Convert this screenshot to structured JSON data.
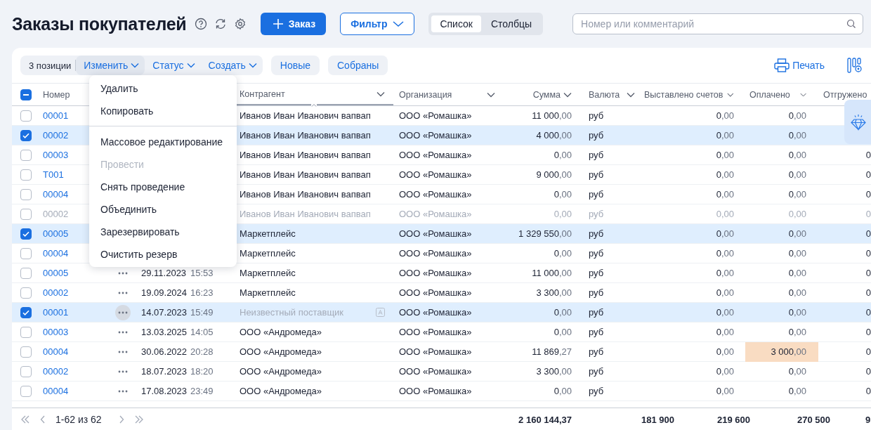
{
  "page": {
    "title": "Заказы покупателей"
  },
  "actions": {
    "add_button": "Заказ",
    "filter_button": "Фильтр",
    "views": [
      {
        "label": "Список",
        "selected": true
      },
      {
        "label": "Столбцы",
        "selected": false
      }
    ],
    "search": {
      "placeholder": "Номер или комментарий"
    }
  },
  "toolbar": {
    "count": "3 позиции",
    "menus": [
      {
        "label": "Изменить",
        "open": true
      },
      {
        "label": "Статус",
        "open": false
      },
      {
        "label": "Создать",
        "open": false
      }
    ],
    "quick_filters": [
      "Новые",
      "Собраны"
    ],
    "print": "Печать"
  },
  "edit_menu": [
    {
      "label": "Удалить",
      "disabled": false,
      "divider_after": false
    },
    {
      "label": "Копировать",
      "disabled": false,
      "divider_after": true
    },
    {
      "label": "Массовое редактирование",
      "disabled": false,
      "divider_after": false
    },
    {
      "label": "Провести",
      "disabled": true,
      "divider_after": false
    },
    {
      "label": "Снять проведение",
      "disabled": false,
      "divider_after": false
    },
    {
      "label": "Объединить",
      "disabled": false,
      "divider_after": false
    },
    {
      "label": "Зарезервировать",
      "disabled": false,
      "divider_after": false
    },
    {
      "label": "Очистить резерв",
      "disabled": false,
      "divider_after": false
    }
  ],
  "table": {
    "select_all": {
      "checked": true,
      "indeterminate": true
    },
    "columns": {
      "number": "Номер",
      "contractor": "Контрагент",
      "organization": "Организация",
      "sum": "Сумма",
      "currency": "Валюта",
      "invoiced": "Выставлено счетов",
      "paid": "Оплачено",
      "shipped": "Отгружено"
    },
    "rows": [
      {
        "number": "00001",
        "checked": false,
        "muted": false,
        "contractor": "Иванов Иван Иванович вапвап",
        "contractor_unknown": false,
        "organization": "ООО «Ромашка»",
        "sum": "11 000,00",
        "currency": "руб",
        "invoiced": "0,00",
        "paid": "0,00",
        "paid_highlight": false
      },
      {
        "number": "00002",
        "checked": true,
        "muted": false,
        "contractor": "Иванов Иван Иванович вапвап",
        "contractor_unknown": false,
        "organization": "ООО «Ромашка»",
        "sum": "4 000,00",
        "currency": "руб",
        "invoiced": "0,00",
        "paid": "0,00",
        "paid_highlight": false
      },
      {
        "number": "00003",
        "checked": false,
        "muted": false,
        "contractor": "Иванов Иван Иванович вапвап",
        "contractor_unknown": false,
        "organization": "ООО «Ромашка»",
        "sum": "0,00",
        "currency": "руб",
        "invoiced": "0,00",
        "paid": "0,00",
        "paid_highlight": false,
        "shipped": "0"
      },
      {
        "number": "T001",
        "checked": false,
        "muted": false,
        "contractor": "Иванов Иван Иванович вапвап",
        "contractor_unknown": false,
        "organization": "ООО «Ромашка»",
        "sum": "9 000,00",
        "currency": "руб",
        "invoiced": "0,00",
        "paid": "0,00",
        "paid_highlight": false,
        "shipped": "0"
      },
      {
        "number": "00004",
        "checked": false,
        "muted": false,
        "contractor": "Иванов Иван Иванович вапвап",
        "contractor_unknown": false,
        "organization": "ООО «Ромашка»",
        "sum": "0,00",
        "currency": "руб",
        "invoiced": "0,00",
        "paid": "0,00",
        "paid_highlight": false,
        "shipped": "0"
      },
      {
        "number": "00002",
        "checked": false,
        "muted": true,
        "contractor": "Иванов Иван Иванович вапвап",
        "contractor_unknown": false,
        "organization": "ООО «Ромашка»",
        "sum": "0,00",
        "currency": "руб",
        "invoiced": "0,00",
        "paid": "0,00",
        "paid_highlight": false,
        "shipped": "0"
      },
      {
        "number": "00005",
        "checked": true,
        "muted": false,
        "contractor": "Маркетплейс",
        "contractor_unknown": false,
        "organization": "ООО «Ромашка»",
        "sum": "1 329 550,00",
        "currency": "руб",
        "invoiced": "0,00",
        "paid": "0,00",
        "paid_highlight": false,
        "shipped": "0"
      },
      {
        "number": "00004",
        "checked": false,
        "muted": false,
        "contractor": "Маркетплейс",
        "contractor_unknown": false,
        "organization": "ООО «Ромашка»",
        "sum": "0,00",
        "currency": "руб",
        "invoiced": "0,00",
        "paid": "0,00",
        "paid_highlight": false,
        "shipped": "0"
      },
      {
        "number": "00005",
        "checked": false,
        "muted": false,
        "date": "29.11.2023",
        "time": "15:53",
        "contractor": "Маркетплейс",
        "contractor_unknown": false,
        "organization": "ООО «Ромашка»",
        "sum": "11 000,00",
        "currency": "руб",
        "invoiced": "0,00",
        "paid": "0,00",
        "paid_highlight": false,
        "shipped": "0",
        "actions_hover": false
      },
      {
        "number": "00002",
        "checked": false,
        "muted": false,
        "date": "19.09.2024",
        "time": "16:23",
        "contractor": "Маркетплейс",
        "contractor_unknown": false,
        "organization": "ООО «Ромашка»",
        "sum": "3 300,00",
        "currency": "руб",
        "invoiced": "0,00",
        "paid": "0,00",
        "paid_highlight": false,
        "shipped": "0",
        "actions_hover": false
      },
      {
        "number": "00001",
        "checked": true,
        "muted": false,
        "date": "14.07.2023",
        "time": "15:49",
        "contractor": "Неизвестный поставщик",
        "contractor_unknown": true,
        "organization": "ООО «Ромашка»",
        "sum": "0,00",
        "currency": "руб",
        "invoiced": "0,00",
        "paid": "0,00",
        "paid_highlight": false,
        "shipped": "0",
        "actions_hover": true
      },
      {
        "number": "00003",
        "checked": false,
        "muted": false,
        "date": "13.03.2025",
        "time": "14:05",
        "contractor": "ООО «Андромеда»",
        "contractor_unknown": false,
        "organization": "ООО «Ромашка»",
        "sum": "0,00",
        "currency": "руб",
        "invoiced": "0,00",
        "paid": "0,00",
        "paid_highlight": false,
        "shipped": "0",
        "actions_hover": false
      },
      {
        "number": "00004",
        "checked": false,
        "muted": false,
        "date": "30.06.2022",
        "time": "20:28",
        "contractor": "ООО «Андромеда»",
        "contractor_unknown": false,
        "organization": "ООО «Ромашка»",
        "sum": "11 869,27",
        "currency": "руб",
        "invoiced": "0,00",
        "paid": "3 000,00",
        "paid_highlight": true,
        "shipped": "0",
        "actions_hover": false
      },
      {
        "number": "00002",
        "checked": false,
        "muted": false,
        "date": "18.07.2023",
        "time": "18:20",
        "contractor": "ООО «Андромеда»",
        "contractor_unknown": false,
        "organization": "ООО «Ромашка»",
        "sum": "3 300,00",
        "currency": "руб",
        "invoiced": "0,00",
        "paid": "0,00",
        "paid_highlight": false,
        "shipped": "0",
        "actions_hover": false
      },
      {
        "number": "00004",
        "checked": false,
        "muted": false,
        "date": "17.08.2023",
        "time": "23:49",
        "contractor": "ООО «Андромеда»",
        "contractor_unknown": false,
        "organization": "ООО «Ромашка»",
        "sum": "0,00",
        "currency": "руб",
        "invoiced": "0,00",
        "paid": "0,00",
        "paid_highlight": false,
        "shipped": "0",
        "actions_hover": false
      }
    ],
    "totals": [
      "2 160 144,37",
      "181 900",
      "219 600",
      "270 500",
      "9"
    ]
  },
  "pagination": {
    "range": "1-62 из 62"
  }
}
